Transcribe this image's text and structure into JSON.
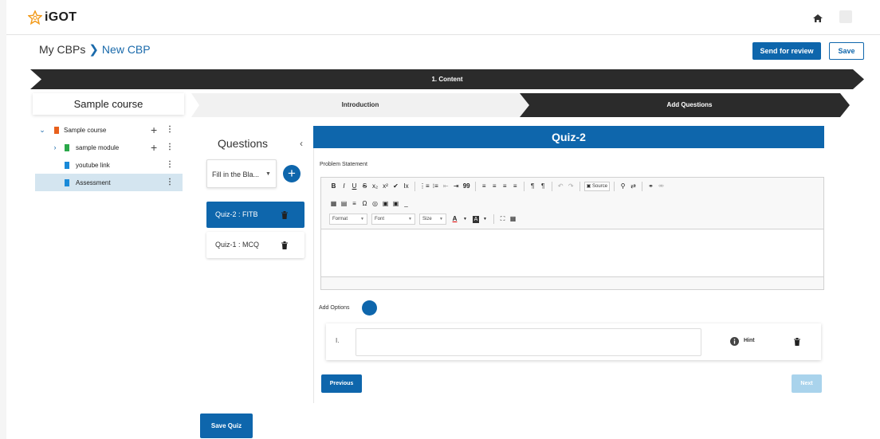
{
  "header": {
    "logo_text": "iGOT",
    "home_icon": "home-icon",
    "avatar_icon": "avatar-placeholder"
  },
  "breadcrumb": {
    "root": "My CBPs",
    "separator": "❯",
    "current": "New CBP"
  },
  "actions": {
    "send_review_label": "Send for review",
    "save_label": "Save"
  },
  "stage": {
    "label": "1. Content"
  },
  "course": {
    "title": "Sample course",
    "tree": [
      {
        "label": "Sample course",
        "type": "course",
        "expanded": true,
        "color": "#e8601c"
      },
      {
        "label": "sample module",
        "type": "module",
        "expanded": false,
        "color": "#2ba84a"
      },
      {
        "label": "youtube link",
        "type": "resource",
        "color": "#1a8ad8"
      },
      {
        "label": "Assessment",
        "type": "resource",
        "color": "#1a8ad8",
        "selected": true
      }
    ]
  },
  "substeps": {
    "introduction": "Introduction",
    "add_questions": "Add Questions"
  },
  "questions": {
    "header": "Questions",
    "collapse_symbol": "‹",
    "type_select": "Fill in the Bla...",
    "items": [
      {
        "label": "Quiz-2 : FITB",
        "active": true
      },
      {
        "label": "Quiz-1 : MCQ",
        "active": false
      }
    ],
    "save_quiz_label": "Save Quiz"
  },
  "editor": {
    "quiz_title": "Quiz-2",
    "problem_statement_label": "Problem Statement",
    "toolbar_row1": [
      "B",
      "I",
      "U",
      "S",
      "x₂",
      "x²",
      "✔",
      "Ix",
      "|",
      "⋮≡",
      "⁝≡",
      "⇤",
      "⇥",
      "99",
      "|",
      "≡",
      "≡",
      "≡",
      "≡",
      "|",
      "¶",
      "¶",
      "|",
      "↶",
      "↷",
      "|"
    ],
    "source_label": "Source",
    "toolbar_row2": [
      "▦",
      "▤",
      "≡",
      "Ω",
      "◎",
      "▣",
      "▣",
      "_"
    ],
    "combos": [
      "Format",
      "Font",
      "Size"
    ],
    "add_options_label": "Add Options",
    "option_number": "I.",
    "hint_label": "Hint",
    "previous_label": "Previous",
    "next_label": "Next"
  },
  "colors": {
    "primary": "#0e66ac",
    "stage_dark": "#2b2b2b",
    "selected_row": "#d4e5f0",
    "next_disabled": "#a9d3ec"
  }
}
